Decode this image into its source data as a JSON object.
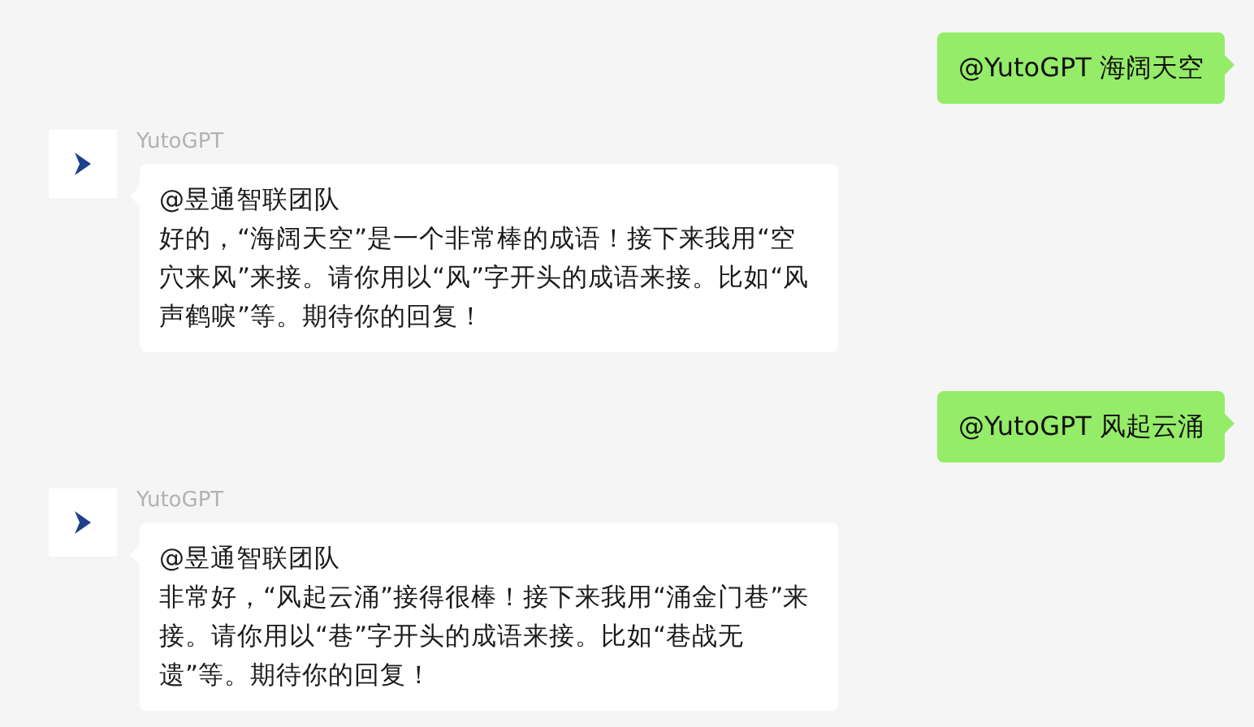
{
  "messages": [
    {
      "kind": "sent",
      "text": "@YutoGPT 海阔天空"
    },
    {
      "kind": "received",
      "sender": "YutoGPT",
      "mention": "@昱通智联团队",
      "text": "好的，“海阔天空”是一个非常棒的成语！接下来我用“空穴来风”来接。请你用以“风”字开头的成语来接。比如“风声鹤唳”等。期待你的回复！"
    },
    {
      "kind": "sent",
      "text": "@YutoGPT 风起云涌"
    },
    {
      "kind": "received",
      "sender": "YutoGPT",
      "mention": "@昱通智联团队",
      "text": "非常好，“风起云涌”接得很棒！接下来我用“涌金门巷”来接。请你用以“巷”字开头的成语来接。比如“巷战无遗”等。期待你的回复！"
    }
  ]
}
